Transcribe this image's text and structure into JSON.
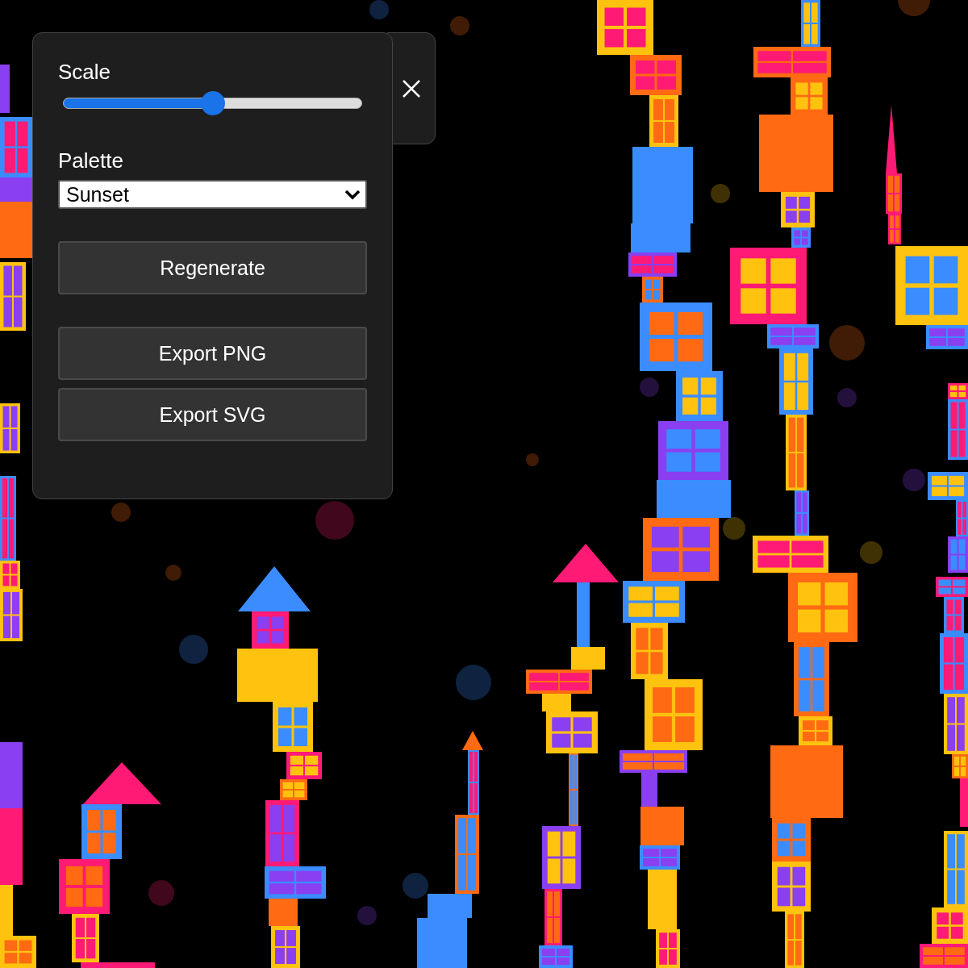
{
  "controls": {
    "scale": {
      "label": "Scale",
      "level": 0.5
    },
    "palette": {
      "label": "Palette",
      "value": "Sunset"
    },
    "actions": [
      "Regenerate"
    ],
    "exports": [
      "Export PNG",
      "Export SVG"
    ]
  }
}
